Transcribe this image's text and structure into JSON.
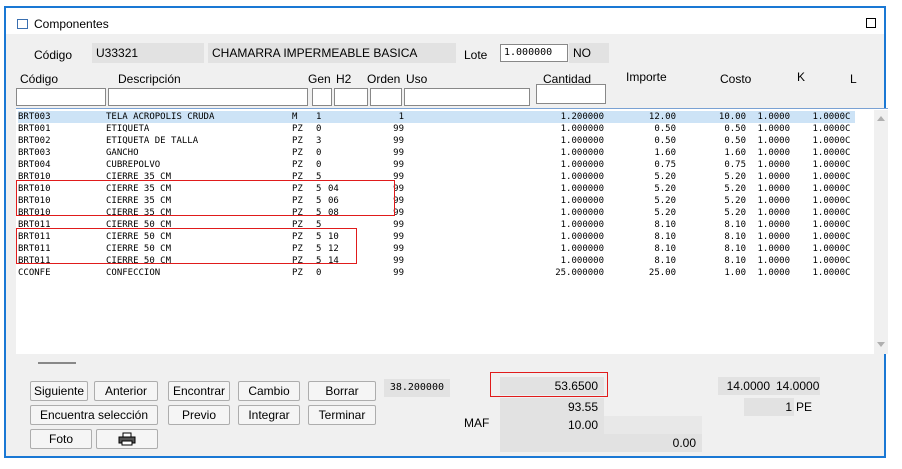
{
  "window": {
    "title": "Componentes"
  },
  "header": {
    "codigo_label": "Código",
    "codigo_value": "U33321",
    "descripcion_value": "CHAMARRA IMPERMEABLE BASICA",
    "lote_label": "Lote",
    "lote_value": "1.000000",
    "no_value": "NO"
  },
  "columns": {
    "codigo": "Código",
    "descripcion": "Descripción",
    "gen": "Gen",
    "h2": "H2",
    "orden": "Orden",
    "uso": "Uso",
    "cantidad": "Cantidad",
    "importe": "Importe",
    "costo": "Costo",
    "k": "K",
    "l": "L"
  },
  "rows": [
    [
      "BRT003",
      "TELA ACROPOLIS CRUDA",
      "M",
      "1",
      "",
      "1",
      "1.200000",
      "12.00",
      "10.00",
      "1.0000",
      "1.0000",
      "C"
    ],
    [
      "BRT001",
      "ETIQUETA",
      "PZ",
      "0",
      "",
      "99",
      "1.000000",
      "0.50",
      "0.50",
      "1.0000",
      "1.0000",
      "C"
    ],
    [
      "BRT002",
      "ETIQUETA DE TALLA",
      "PZ",
      "3",
      "",
      "99",
      "1.000000",
      "0.50",
      "0.50",
      "1.0000",
      "1.0000",
      "C"
    ],
    [
      "BRT003",
      "GANCHO",
      "PZ",
      "0",
      "",
      "99",
      "1.000000",
      "1.60",
      "1.60",
      "1.0000",
      "1.0000",
      "C"
    ],
    [
      "BRT004",
      "CUBREPOLVO",
      "PZ",
      "0",
      "",
      "99",
      "1.000000",
      "0.75",
      "0.75",
      "1.0000",
      "1.0000",
      "C"
    ],
    [
      "BRT010",
      "CIERRE 35 CM",
      "PZ",
      "5",
      "",
      "99",
      "1.000000",
      "5.20",
      "5.20",
      "1.0000",
      "1.0000",
      "C"
    ],
    [
      "BRT010",
      "CIERRE 35 CM",
      "PZ",
      "5",
      "04",
      "99",
      "1.000000",
      "5.20",
      "5.20",
      "1.0000",
      "1.0000",
      "C"
    ],
    [
      "BRT010",
      "CIERRE 35 CM",
      "PZ",
      "5",
      "06",
      "99",
      "1.000000",
      "5.20",
      "5.20",
      "1.0000",
      "1.0000",
      "C"
    ],
    [
      "BRT010",
      "CIERRE 35 CM",
      "PZ",
      "5",
      "08",
      "99",
      "1.000000",
      "5.20",
      "5.20",
      "1.0000",
      "1.0000",
      "C"
    ],
    [
      "BRT011",
      "CIERRE 50 CM",
      "PZ",
      "5",
      "",
      "99",
      "1.000000",
      "8.10",
      "8.10",
      "1.0000",
      "1.0000",
      "C"
    ],
    [
      "BRT011",
      "CIERRE 50 CM",
      "PZ",
      "5",
      "10",
      "99",
      "1.000000",
      "8.10",
      "8.10",
      "1.0000",
      "1.0000",
      "C"
    ],
    [
      "BRT011",
      "CIERRE 50 CM",
      "PZ",
      "5",
      "12",
      "99",
      "1.000000",
      "8.10",
      "8.10",
      "1.0000",
      "1.0000",
      "C"
    ],
    [
      "BRT011",
      "CIERRE 50 CM",
      "PZ",
      "5",
      "14",
      "99",
      "1.000000",
      "8.10",
      "8.10",
      "1.0000",
      "1.0000",
      "C"
    ],
    [
      "CCONFE",
      "CONFECCION",
      "PZ",
      "0",
      "",
      "99",
      "25.000000",
      "25.00",
      "1.00",
      "1.0000",
      "1.0000",
      "C"
    ]
  ],
  "buttons": {
    "siguiente": "Siguiente",
    "anterior": "Anterior",
    "encontrar": "Encontrar",
    "cambio": "Cambio",
    "borrar": "Borrar",
    "encuentra_seleccion": "Encuentra selección",
    "previo": "Previo",
    "integrar": "Integrar",
    "terminar": "Terminar",
    "foto": "Foto",
    "print_icon": "printer-icon"
  },
  "totals": {
    "cantidad_total": "38.200000",
    "importe_total": "53.6500",
    "subtotal": "93.55",
    "maf_label": "MAF",
    "maf_value": "10.00",
    "extra_value": "0.00",
    "k_total": "14.0000",
    "l_total": "14.0000",
    "pe_count": "1",
    "pe_label": "PE"
  },
  "colors": {
    "title_border": "#1a78d4",
    "highlight": "#e01b1b",
    "selected_row": "#cde3f6"
  }
}
